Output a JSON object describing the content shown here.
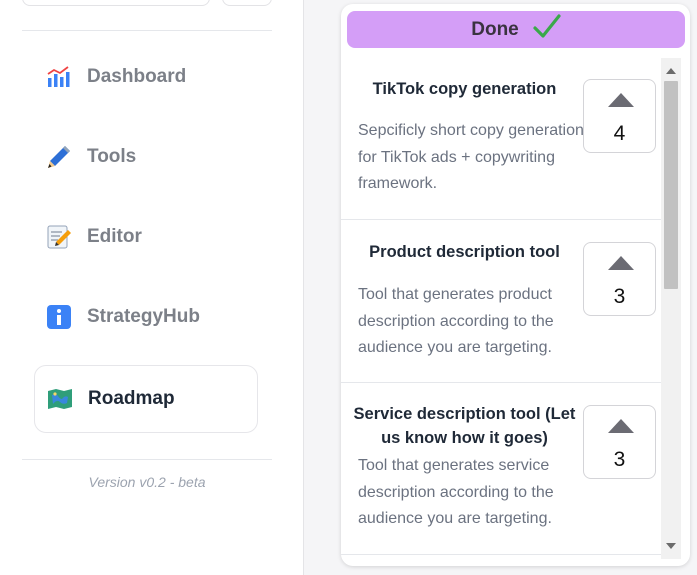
{
  "sidebar": {
    "items": [
      {
        "label": "Dashboard",
        "icon": "bar-chart-icon"
      },
      {
        "label": "Tools",
        "icon": "pen-icon"
      },
      {
        "label": "Editor",
        "icon": "memo-icon"
      },
      {
        "label": "StrategyHub",
        "icon": "info-icon"
      },
      {
        "label": "Roadmap",
        "icon": "map-icon"
      }
    ],
    "version": "Version v0.2 - beta"
  },
  "done_column": {
    "title": "Done",
    "items": [
      {
        "title": "TikTok copy generation",
        "description": "Sepcificly short copy generation for TikTok ads + copywriting framework.",
        "votes": "4"
      },
      {
        "title": "Product description tool",
        "description": "Tool that generates product description according to the audience you are targeting.",
        "votes": "3"
      },
      {
        "title": "Service description tool (Let us know how it goes)",
        "description": "Tool that generates service description according to the audience you are targeting.",
        "votes": "3"
      }
    ]
  },
  "colors": {
    "done_header": "#d49ef7",
    "check": "#3aa84a",
    "scroll_thumb": "#c1c1c1"
  }
}
